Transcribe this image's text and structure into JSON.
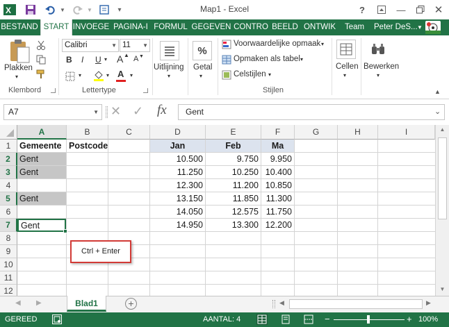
{
  "window": {
    "title": "Map1 - Excel"
  },
  "tabs": [
    "BESTAND",
    "START",
    "INVOEGE",
    "PAGINA-I",
    "FORMUL",
    "GEGEVEN",
    "CONTRO",
    "BEELD",
    "ONTWIK",
    "Team"
  ],
  "user": {
    "name": "Peter DeS..."
  },
  "ribbon": {
    "clipboard": {
      "paste": "Plakken",
      "label": "Klembord"
    },
    "font": {
      "name": "Calibri",
      "size": "11",
      "label": "Lettertype",
      "bold": "B",
      "italic": "I",
      "underline": "U",
      "grow": "A",
      "shrink": "A",
      "color": "A"
    },
    "alignment": {
      "label": "Uitlijning"
    },
    "number": {
      "label": "Getal",
      "symbol": "%"
    },
    "styles": {
      "conditional": "Voorwaardelijke opmaak",
      "table": "Opmaken als tabel",
      "cell_styles": "Celstijlen",
      "label": "Stijlen"
    },
    "cells": {
      "label": "Cellen"
    },
    "editing": {
      "label": "Bewerken"
    }
  },
  "formula_bar": {
    "name_box": "A7",
    "fx": "fx",
    "value": "Gent"
  },
  "grid": {
    "columns": [
      "A",
      "B",
      "C",
      "D",
      "E",
      "F",
      "G",
      "H",
      "I"
    ],
    "rows": [
      "1",
      "2",
      "3",
      "4",
      "5",
      "6",
      "7",
      "8",
      "9",
      "10",
      "11",
      "12"
    ],
    "headers": {
      "a1": "Gemeente",
      "b1": "Postcode",
      "d1": "Jan",
      "e1": "Feb",
      "f1": "Ma"
    },
    "col_a": [
      "Gent",
      "Gent",
      "",
      "Gent",
      "",
      "Gent"
    ],
    "col_d": [
      "10.500",
      "11.250",
      "12.300",
      "13.150",
      "14.050",
      "14.950"
    ],
    "col_e": [
      "9.750",
      "10.250",
      "11.200",
      "11.850",
      "12.575",
      "13.300"
    ],
    "col_f": [
      "9.950",
      "10.400",
      "10.850",
      "11.300",
      "11.750",
      "12.200"
    ]
  },
  "callout": {
    "text": "Ctrl + Enter"
  },
  "sheets": {
    "active": "Blad1"
  },
  "status": {
    "mode": "GEREED",
    "count": "AANTAL: 4",
    "zoom": "100%"
  },
  "colors": {
    "accent": "#217346",
    "selection": "#c6c6c6",
    "header_fill": "#dce3ee",
    "callout_border": "#d23a36"
  }
}
